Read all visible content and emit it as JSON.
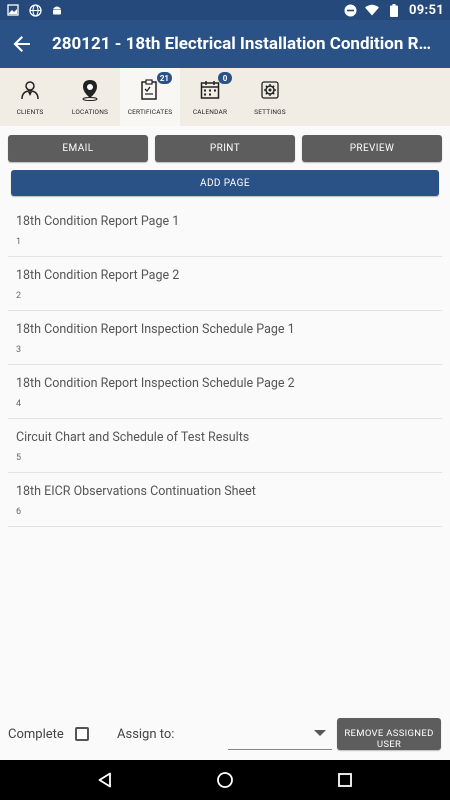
{
  "status_bar": {
    "time": "09:51",
    "icons": [
      "image-icon",
      "globe-icon",
      "android-icon",
      "minus-circle-icon",
      "wifi-icon",
      "battery-icon"
    ]
  },
  "app_bar": {
    "title": "280121 - 18th Electrical Installation Condition Re...",
    "back_icon": "arrow-back-icon"
  },
  "tabs": [
    {
      "label": "CLIENTS",
      "icon": "person-icon",
      "badge": ""
    },
    {
      "label": "LOCATIONS",
      "icon": "map-pin-icon",
      "badge": ""
    },
    {
      "label": "CERTIFICATES",
      "icon": "certificate-icon",
      "badge": "21"
    },
    {
      "label": "CALENDAR",
      "icon": "calendar-icon",
      "badge": "0"
    },
    {
      "label": "SETTINGS",
      "icon": "gear-icon",
      "badge": ""
    }
  ],
  "actions": {
    "email": "EMAIL",
    "print": "PRINT",
    "preview": "PREVIEW",
    "add_page": "ADD PAGE"
  },
  "pages": [
    {
      "title": "18th Condition Report Page 1",
      "number": "1"
    },
    {
      "title": "18th Condition Report Page 2",
      "number": "2"
    },
    {
      "title": "18th Condition Report Inspection Schedule Page 1",
      "number": "3"
    },
    {
      "title": "18th Condition Report Inspection Schedule Page 2",
      "number": "4"
    },
    {
      "title": "Circuit Chart and Schedule of Test Results",
      "number": "5"
    },
    {
      "title": "18th EICR Observations Continuation Sheet",
      "number": "6"
    }
  ],
  "footer": {
    "complete_label": "Complete",
    "complete_checked": false,
    "assign_label": "Assign to:",
    "assign_value": "",
    "remove_label": "REMOVE ASSIGNED USER"
  },
  "colors": {
    "primary": "#2a5286",
    "status_bar": "#24497a",
    "button_gray": "#5d5d5d",
    "tab_bg": "#f1ede4"
  }
}
